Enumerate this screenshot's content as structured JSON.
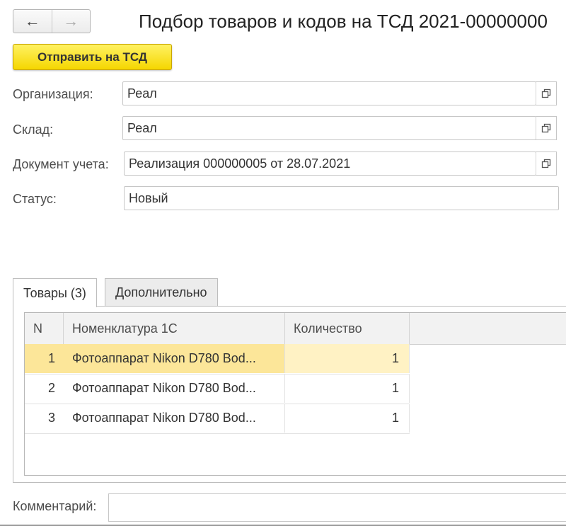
{
  "window": {
    "title": "Подбор товаров и кодов на ТСД 2021-00000000"
  },
  "nav": {
    "back_icon": "arrow-left-icon",
    "forward_icon": "arrow-right-icon"
  },
  "toolbar": {
    "send_label": "Отправить на ТСД",
    "accent_color": "#f5d600"
  },
  "form": {
    "organization": {
      "label": "Организация:",
      "value": "Реал"
    },
    "warehouse": {
      "label": "Склад:",
      "value": "Реал"
    },
    "document": {
      "label": "Документ учета:",
      "value": "Реализация 000000005 от 28.07.2021"
    },
    "status": {
      "label": "Статус:",
      "value": "Новый"
    }
  },
  "tabs": [
    {
      "label": "Товары (3)",
      "active": true
    },
    {
      "label": "Дополнительно",
      "active": false
    }
  ],
  "table": {
    "columns": [
      "N",
      "Номенклатура 1С",
      "Количество"
    ],
    "rows": [
      {
        "n": "1",
        "name": "Фотоаппарат Nikon D780 Bod...",
        "qty": "1",
        "selected": true
      },
      {
        "n": "2",
        "name": "Фотоаппарат Nikon D780 Bod...",
        "qty": "1",
        "selected": false
      },
      {
        "n": "3",
        "name": "Фотоаппарат Nikon D780 Bod...",
        "qty": "1",
        "selected": false
      }
    ],
    "selection_color": "#fce699"
  },
  "comment": {
    "label": "Комментарий:",
    "value": ""
  }
}
